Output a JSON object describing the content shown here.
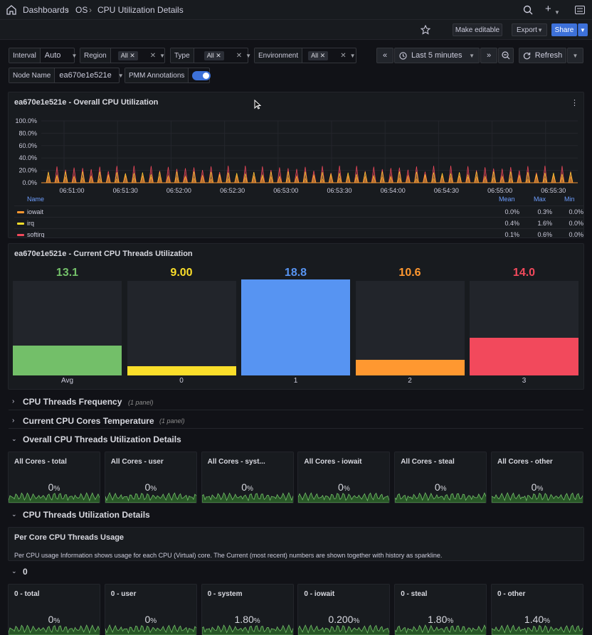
{
  "breadcrumb": {
    "home": "Dashboards",
    "section": "OS",
    "page": "CPU Utilization Details"
  },
  "toolbar": {
    "make_editable": "Make editable",
    "export": "Export",
    "share": "Share"
  },
  "variables": {
    "interval": {
      "label": "Interval",
      "value": "Auto"
    },
    "region": {
      "label": "Region",
      "value": "All"
    },
    "type": {
      "label": "Type",
      "value": "All"
    },
    "environment": {
      "label": "Environment",
      "value": "All"
    },
    "node_name": {
      "label": "Node Name",
      "value": "ea670e1e521e"
    },
    "pmm_annotations": {
      "label": "PMM Annotations",
      "enabled": true
    }
  },
  "time": {
    "range": "Last 5 minutes",
    "refresh": "Refresh"
  },
  "overall_panel": {
    "title": "ea670e1e521e - Overall CPU Utilization",
    "legend_header": {
      "name": "Name",
      "mean": "Mean",
      "max": "Max",
      "min": "Min"
    },
    "legend": [
      {
        "name": "iowait",
        "mean": "0.0%",
        "max": "0.3%",
        "min": "0.0%",
        "color": "#ff9830"
      },
      {
        "name": "irq",
        "mean": "0.4%",
        "max": "1.6%",
        "min": "0.0%",
        "color": "#fade2a"
      },
      {
        "name": "softirq",
        "mean": "0.1%",
        "max": "0.6%",
        "min": "0.0%",
        "color": "#f2495c"
      }
    ]
  },
  "chart_data": [
    {
      "type": "area",
      "title": "ea670e1e521e - Overall CPU Utilization",
      "y_ticks": [
        "100.0%",
        "80.0%",
        "60.0%",
        "40.0%",
        "20.0%",
        "0.0%"
      ],
      "ylim": [
        0,
        100
      ],
      "x_ticks": [
        "06:51:00",
        "06:51:30",
        "06:52:00",
        "06:52:30",
        "06:53:00",
        "06:53:30",
        "06:54:00",
        "06:54:30",
        "06:55:00",
        "06:55:30"
      ],
      "series": [
        {
          "name": "iowait",
          "color": "#ff9830"
        },
        {
          "name": "irq",
          "color": "#fade2a"
        },
        {
          "name": "softirq",
          "color": "#f2495c"
        }
      ]
    },
    {
      "type": "bar",
      "title": "ea670e1e521e - Current CPU Threads Utilization",
      "categories": [
        "Avg",
        "0",
        "1",
        "2",
        "3"
      ],
      "values": [
        13.1,
        9.0,
        18.8,
        10.6,
        14.0
      ],
      "labels": [
        "13.1",
        "9.00",
        "18.8",
        "10.6",
        "14.0"
      ],
      "colors": [
        "#73bf69",
        "#fade2a",
        "#5794f2",
        "#ff9830",
        "#f2495c"
      ]
    }
  ],
  "threads_panel": {
    "title": "ea670e1e521e - Current CPU Threads Utilization"
  },
  "rows": {
    "freq": {
      "title": "CPU Threads Frequency",
      "count": "(1 panel)"
    },
    "temp": {
      "title": "Current CPU Cores Temperature",
      "count": "(1 panel)"
    },
    "overall_details": {
      "title": "Overall CPU Threads Utilization Details"
    },
    "util_details": {
      "title": "CPU Threads Utilization Details"
    },
    "core0": {
      "title": "0"
    }
  },
  "all_cores": [
    {
      "title": "All Cores - total",
      "value": "0",
      "unit": "%"
    },
    {
      "title": "All Cores - user",
      "value": "0",
      "unit": "%"
    },
    {
      "title": "All Cores - syst...",
      "value": "0",
      "unit": "%"
    },
    {
      "title": "All Cores - iowait",
      "value": "0",
      "unit": "%"
    },
    {
      "title": "All Cores - steal",
      "value": "0",
      "unit": "%"
    },
    {
      "title": "All Cores - other",
      "value": "0",
      "unit": "%"
    }
  ],
  "per_core_panel": {
    "title": "Per Core CPU Threads Usage",
    "text": "Per CPU usage Information shows usage for each CPU (Virtual) core. The Current (most recent) numbers are shown together with history as sparkline."
  },
  "core0_stats": [
    {
      "title": "0 - total",
      "value": "0",
      "unit": "%"
    },
    {
      "title": "0 - user",
      "value": "0",
      "unit": "%"
    },
    {
      "title": "0 - system",
      "value": "1.80",
      "unit": "%"
    },
    {
      "title": "0 - iowait",
      "value": "0.200",
      "unit": "%"
    },
    {
      "title": "0 - steal",
      "value": "1.80",
      "unit": "%"
    },
    {
      "title": "0 - other",
      "value": "1.40",
      "unit": "%"
    }
  ]
}
